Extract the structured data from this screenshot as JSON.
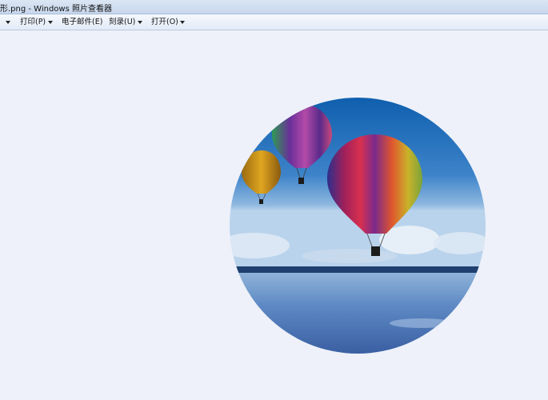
{
  "window": {
    "title": "形.png - Windows 照片查看器"
  },
  "menu": {
    "items": [
      {
        "label": "打印(P)"
      },
      {
        "label": "电子邮件(E)"
      },
      {
        "label": "刻录(U)"
      },
      {
        "label": "打开(O)"
      }
    ]
  },
  "viewer": {
    "image_subject": "hot air balloons over lake, circular crop",
    "background_color": "#eef1f9"
  },
  "icons": [
    "chevron-down-icon"
  ]
}
